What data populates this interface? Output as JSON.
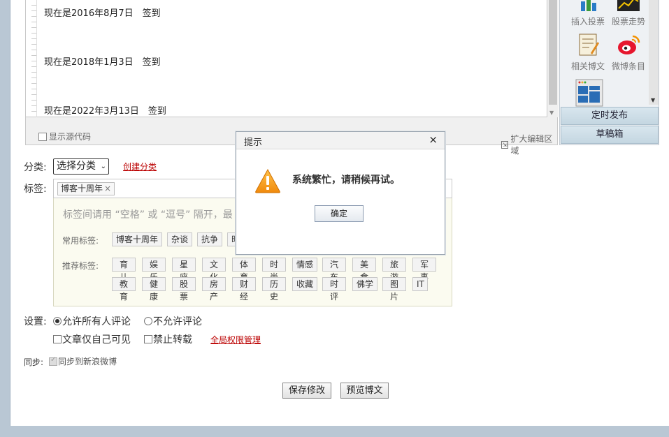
{
  "editor": {
    "lines": [
      "现在是2016年8月7日　签到",
      "现在是2018年1月3日　签到",
      "现在是2022年3月13日　签到"
    ],
    "show_source_label": "显示源代码",
    "expand_label": "扩大编辑区域"
  },
  "sidebar": {
    "tools": [
      {
        "label": "插入投票",
        "icon": "poll-icon"
      },
      {
        "label": "股票走势",
        "icon": "stock-chart-icon"
      },
      {
        "label": "相关博文",
        "icon": "related-posts-icon"
      },
      {
        "label": "微博条目",
        "icon": "weibo-icon"
      },
      {
        "label": "",
        "icon": "layout-template-icon"
      }
    ],
    "scheduled_publish": "定时发布",
    "drafts": "草稿箱"
  },
  "category": {
    "label": "分类:",
    "select_value": "选择分类",
    "create_link": "创建分类"
  },
  "tags": {
    "label": "标签:",
    "chip": "博客十周年",
    "hint": "标签间请用 “空格” 或 “逗号” 隔开，最",
    "common_label": "常用标签:",
    "common": [
      "博客十周年",
      "杂谈",
      "抗争",
      "时"
    ],
    "recommended_label": "推荐标签:",
    "recommended_row1": [
      "育儿",
      "娱乐",
      "星座",
      "文化",
      "体育",
      "时尚",
      "情感",
      "汽车",
      "美食",
      "旅游",
      "军事"
    ],
    "recommended_row2": [
      "教育",
      "健康",
      "股票",
      "房产",
      "财经",
      "历史",
      "收藏",
      "时评",
      "佛学",
      "图片",
      "IT"
    ]
  },
  "settings": {
    "label": "设置:",
    "allow_all_comments": "允许所有人评论",
    "disallow_comments": "不允许评论",
    "private_only": "文章仅自己可见",
    "no_repost": "禁止转载",
    "global_permissions": "全局权限管理"
  },
  "sync": {
    "label": "同步:",
    "weibo_sync": "同步到新浪微博"
  },
  "actions": {
    "save": "保存修改",
    "preview": "预览博文"
  },
  "dialog": {
    "title": "提示",
    "close": "×",
    "message": "系统繁忙，请稍候再试。",
    "ok": "确定"
  },
  "colors": {
    "link_red": "#b00000",
    "warning_orange": "#f39a1e",
    "side_button": "#c8d9e4"
  }
}
